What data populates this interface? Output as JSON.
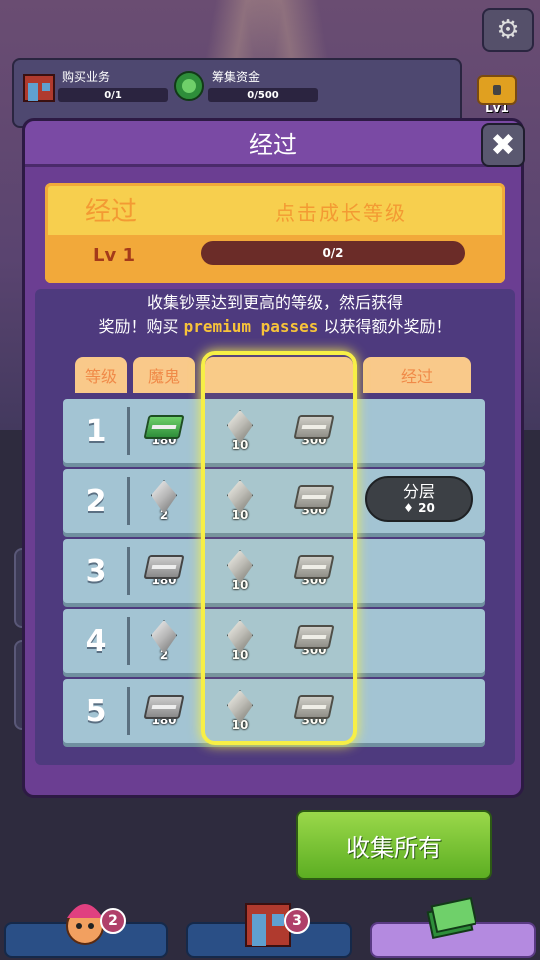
{
  "hud": {
    "business": {
      "label": "购买业务",
      "progress": "0/1",
      "icon": "shop-icon"
    },
    "funds": {
      "label": "筹集资金",
      "progress": "0/500",
      "icon": "money-stack-icon"
    },
    "chest_level": "Lv1"
  },
  "modal": {
    "title": "经过",
    "close_label": "✖",
    "ticket": {
      "title": "经过",
      "tap_text": "点击成长等级",
      "level": "Lv 1",
      "progress": "0/2"
    },
    "description_line1": "收集钞票达到更高的等级，然后获得",
    "description_line2_pre": "奖励！购买",
    "description_premium": "premium passes",
    "description_line2_post": "以获得额外奖励！",
    "columns": {
      "level": "等级",
      "free": "魔鬼",
      "premium": "",
      "pass": "经过"
    },
    "rows": [
      {
        "level": "1",
        "free": {
          "type": "cash-green",
          "amount": "180"
        },
        "premium_gem": "10",
        "premium_cash": "300"
      },
      {
        "level": "2",
        "free": {
          "type": "gem",
          "amount": "2"
        },
        "premium_gem": "10",
        "premium_cash": "300"
      },
      {
        "level": "3",
        "free": {
          "type": "cash",
          "amount": "180"
        },
        "premium_gem": "10",
        "premium_cash": "300"
      },
      {
        "level": "4",
        "free": {
          "type": "gem",
          "amount": "2"
        },
        "premium_gem": "10",
        "premium_cash": "300"
      },
      {
        "level": "5",
        "free": {
          "type": "cash",
          "amount": "180"
        },
        "premium_gem": "10",
        "premium_cash": "300"
      }
    ],
    "tier_button": {
      "label": "分层",
      "cost": "20"
    }
  },
  "collect_all": "收集所有",
  "nav": {
    "characters_badge": "2",
    "buildings_badge": "3"
  },
  "colors": {
    "accent_yellow": "#f7ef46",
    "button_green": "#5cae22",
    "modal_purple": "#6b3e92"
  }
}
